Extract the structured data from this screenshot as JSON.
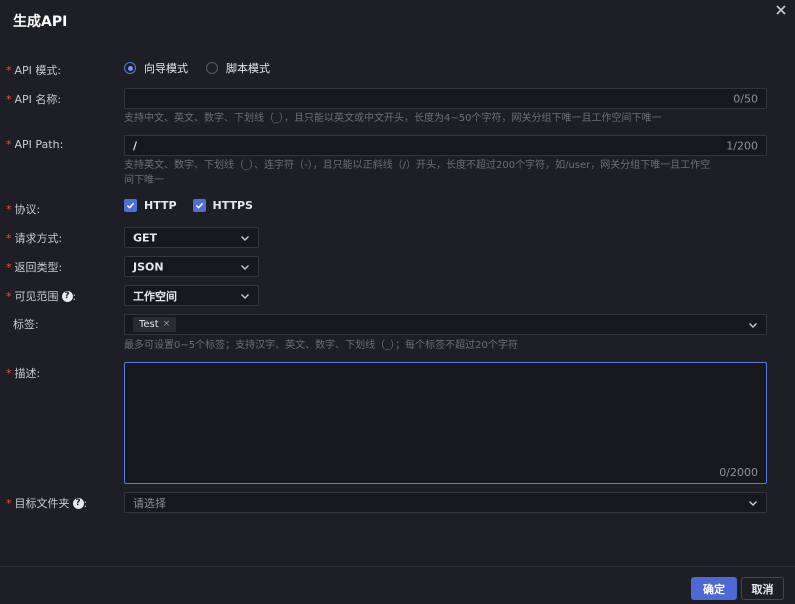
{
  "dialog": {
    "title": "生成API"
  },
  "fields": {
    "mode": {
      "label": "API 模式:",
      "options": [
        "向导模式",
        "脚本模式"
      ],
      "selected": "向导模式"
    },
    "name": {
      "label": "API 名称:",
      "value": "",
      "count": "0/50",
      "hint": "支持中文、英文、数字、下划线（_），且只能以英文或中文开头，长度为4~50个字符，网关分组下唯一且工作空间下唯一"
    },
    "path": {
      "label": "API Path:",
      "value": "/",
      "count": "1/200",
      "hint_line1": "支持英文、数字、下划线（_）、连字符（-），且只能以正斜线（/）开头，长度不超过200个字符，如/user，网关分组下唯一且工作空",
      "hint_line2": "间下唯一"
    },
    "protocol": {
      "label": "协议:",
      "options": [
        "HTTP",
        "HTTPS"
      ],
      "checked": [
        "HTTP",
        "HTTPS"
      ]
    },
    "method": {
      "label": "请求方式:",
      "value": "GET"
    },
    "return_type": {
      "label": "返回类型:",
      "value": "JSON"
    },
    "visibility": {
      "label": "可见范围",
      "colon": ":",
      "value": "工作空间"
    },
    "tags": {
      "label": "标签:",
      "tag": "Test",
      "hint": "最多可设置0~5个标签；支持汉字、英文、数字、下划线（_）；每个标签不超过20个字符"
    },
    "description": {
      "label": "描述:",
      "value": "",
      "count": "0/2000"
    },
    "folder": {
      "label": "目标文件夹",
      "colon": ":",
      "placeholder": "请选择"
    }
  },
  "footer": {
    "confirm": "确定",
    "cancel": "取消"
  },
  "colors": {
    "accent": "#4d6ad4",
    "required": "#e0573e",
    "background": "#1e1f24"
  }
}
